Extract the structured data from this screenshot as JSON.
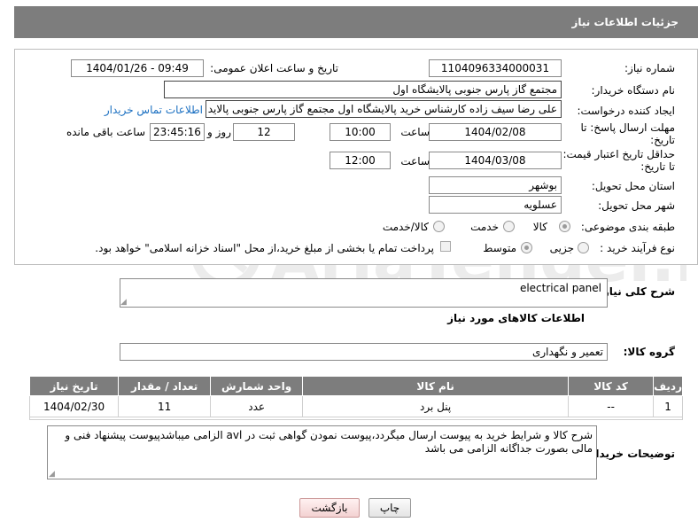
{
  "header": {
    "title": "جزئیات اطلاعات نیاز"
  },
  "form": {
    "need_number": {
      "label": "شماره نیاز:",
      "value": "1104096334000031"
    },
    "announce_datetime": {
      "label": "تاریخ و ساعت اعلان عمومی:",
      "value": "1404/01/26 - 09:49"
    },
    "buyer_org": {
      "label": "نام دستگاه خریدار:",
      "value": "مجتمع گاز پارس جنوبی  پالایشگاه اول"
    },
    "requester": {
      "label": "ایجاد کننده درخواست:",
      "value": "علی رضا سیف زاده کارشناس خرید پالایشگاه اول مجتمع گاز پارس جنوبی  پالاید",
      "contact_link": "اطلاعات تماس خریدار"
    },
    "reply_deadline": {
      "label": "مهلت ارسال پاسخ: تا تاریخ:",
      "date": "1404/02/08",
      "time_label": "ساعت",
      "time": "10:00",
      "days": "12",
      "days_label": "روز و",
      "remaining": "23:45:16",
      "remaining_label": "ساعت باقی مانده"
    },
    "price_validity": {
      "label": "حداقل تاریخ اعتبار قیمت: تا تاریخ:",
      "date": "1404/03/08",
      "time_label": "ساعت",
      "time": "12:00"
    },
    "province": {
      "label": "استان محل تحویل:",
      "value": "بوشهر"
    },
    "city": {
      "label": "شهر محل تحویل:",
      "value": "عسلویه"
    },
    "category": {
      "label": "طبقه بندی موضوعی:",
      "options": [
        "کالا",
        "خدمت",
        "کالا/خدمت"
      ]
    },
    "process_type": {
      "label": "نوع فرآیند خرید :",
      "options": [
        "جزیی",
        "متوسط"
      ],
      "payment_note": "پرداخت تمام یا بخشی از مبلغ خرید،از محل \"اسناد خزانه اسلامی\" خواهد بود."
    }
  },
  "summary": {
    "label": "شرح کلی نیاز:",
    "value": "electrical panel"
  },
  "goods_section_title": "اطلاعات کالاهای مورد نیاز",
  "goods_group": {
    "label": "گروه کالا:",
    "value": "تعمیر و نگهداری"
  },
  "table": {
    "headers": [
      "ردیف",
      "کد کالا",
      "نام کالا",
      "واحد شمارش",
      "تعداد / مقدار",
      "تاریخ نیاز"
    ],
    "rows": [
      [
        "1",
        "--",
        "پنل برد",
        "عدد",
        "11",
        "1404/02/30"
      ]
    ]
  },
  "buyer_notes": {
    "label": "توضیحات خریدار:",
    "value": "شرح کالا و شرایط خرید به پیوست ارسال میگردد،پیوست نمودن گواهی ثبت در avl الزامی میباشدپیوست پیشنهاد فنی و مالی بصورت جداگانه الزامی می باشد"
  },
  "buttons": {
    "print": "چاپ",
    "back": "بازگشت"
  },
  "watermark": {
    "text": "AriaTender.neT"
  },
  "colors": {
    "header_bg": "#7d7d7d",
    "link": "#1a6fc1",
    "watermark": "#ececec"
  }
}
